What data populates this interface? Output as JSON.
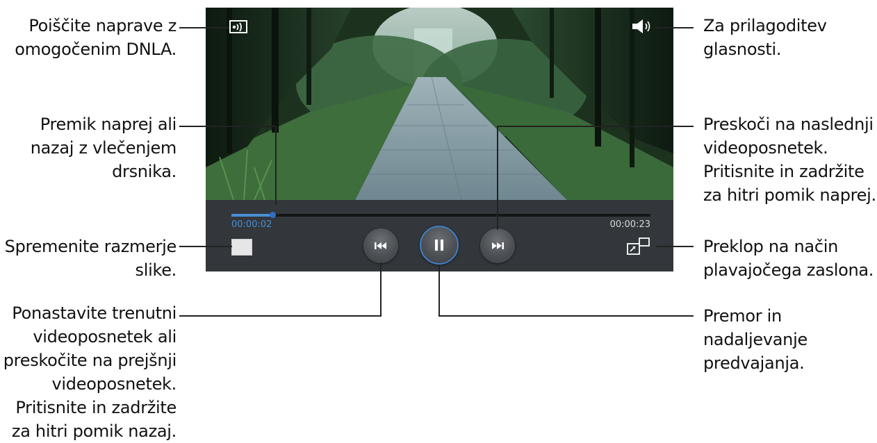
{
  "annotations": {
    "dlna": [
      "Poiščite naprave z",
      "omogočenim DNLA."
    ],
    "seek": [
      "Premik naprej ali",
      "nazaj z vlečenjem",
      "drsnika."
    ],
    "aspect": [
      "Spremenite razmerje",
      "slike."
    ],
    "previous": [
      "Ponastavite trenutni",
      "videoposnetek ali",
      "preskočite na prejšnji",
      "videoposnetek.",
      "Pritisnite in zadržite",
      "za hitri pomik nazaj."
    ],
    "volume": [
      "Za prilagoditev",
      "glasnosti."
    ],
    "next": [
      "Preskoči na naslednji",
      "videoposnetek.",
      "Pritisnite in zadržite",
      "za hitri pomik naprej."
    ],
    "popup": [
      "Preklop na način",
      "plavajočega zaslona."
    ],
    "pause": [
      "Premor in",
      "nadaljevanje",
      "predvajanja."
    ]
  },
  "player": {
    "current_time": "00:00:02",
    "total_time": "00:00:23",
    "progress": 0.1,
    "accent_color": "#4a8fd4"
  },
  "icons": {
    "dlna": "dlna-icon",
    "volume": "volume-icon",
    "aspect": "aspect-ratio-icon",
    "previous": "previous-icon",
    "pause": "pause-icon",
    "next": "next-icon",
    "popup": "popup-player-icon"
  }
}
